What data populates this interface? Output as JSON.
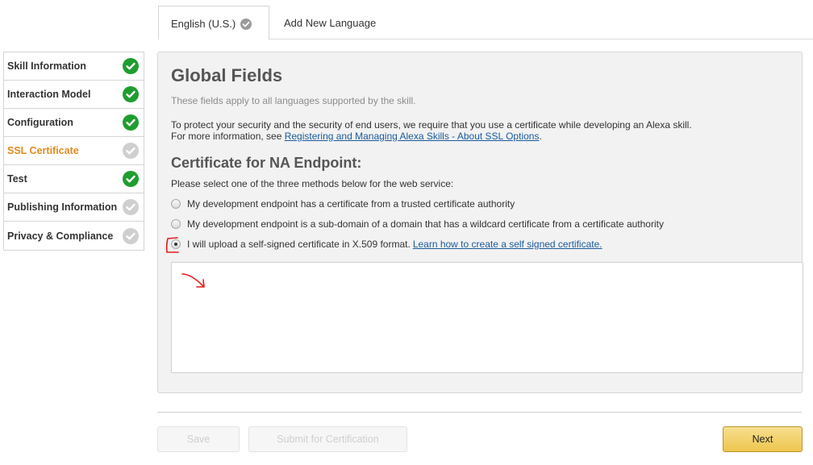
{
  "tabs": {
    "active_label": "English (U.S.)",
    "add_label": "Add New Language"
  },
  "sidebar": {
    "items": [
      {
        "label": "Skill Information",
        "status": "done"
      },
      {
        "label": "Interaction Model",
        "status": "done"
      },
      {
        "label": "Configuration",
        "status": "done"
      },
      {
        "label": "SSL Certificate",
        "status": "todo"
      },
      {
        "label": "Test",
        "status": "done"
      },
      {
        "label": "Publishing Information",
        "status": "todo"
      },
      {
        "label": "Privacy & Compliance",
        "status": "todo"
      }
    ]
  },
  "main": {
    "title": "Global Fields",
    "subtitle": "These fields apply to all languages supported by the skill.",
    "security_text": "To protect your security and the security of end users, we require that you use a certificate while developing an Alexa skill.",
    "more_info_prefix": "For more information, see ",
    "more_info_link": "Registering and Managing Alexa Skills - About SSL Options",
    "more_info_suffix": ".",
    "cert_heading": "Certificate for NA Endpoint:",
    "instruction": "Please select one of the three methods below for the web service:",
    "options": [
      {
        "label": "My development endpoint has a certificate from a trusted certificate authority",
        "checked": false
      },
      {
        "label": "My development endpoint is a sub-domain of a domain that has a wildcard certificate from a certificate authority",
        "checked": false
      },
      {
        "label": "I will upload a self-signed certificate in X.509 format.",
        "link": "Learn how to create a self signed certificate.",
        "checked": true
      }
    ],
    "certificate_value": ""
  },
  "footer": {
    "save_label": "Save",
    "submit_label": "Submit for Certification",
    "next_label": "Next"
  },
  "colors": {
    "done": "#1f9d2f",
    "todo": "#cfcfcf",
    "active_item": "#e08a1e",
    "link": "#1a5a9c",
    "annotation": "#e31b1b",
    "next_button": "#eec54e"
  }
}
